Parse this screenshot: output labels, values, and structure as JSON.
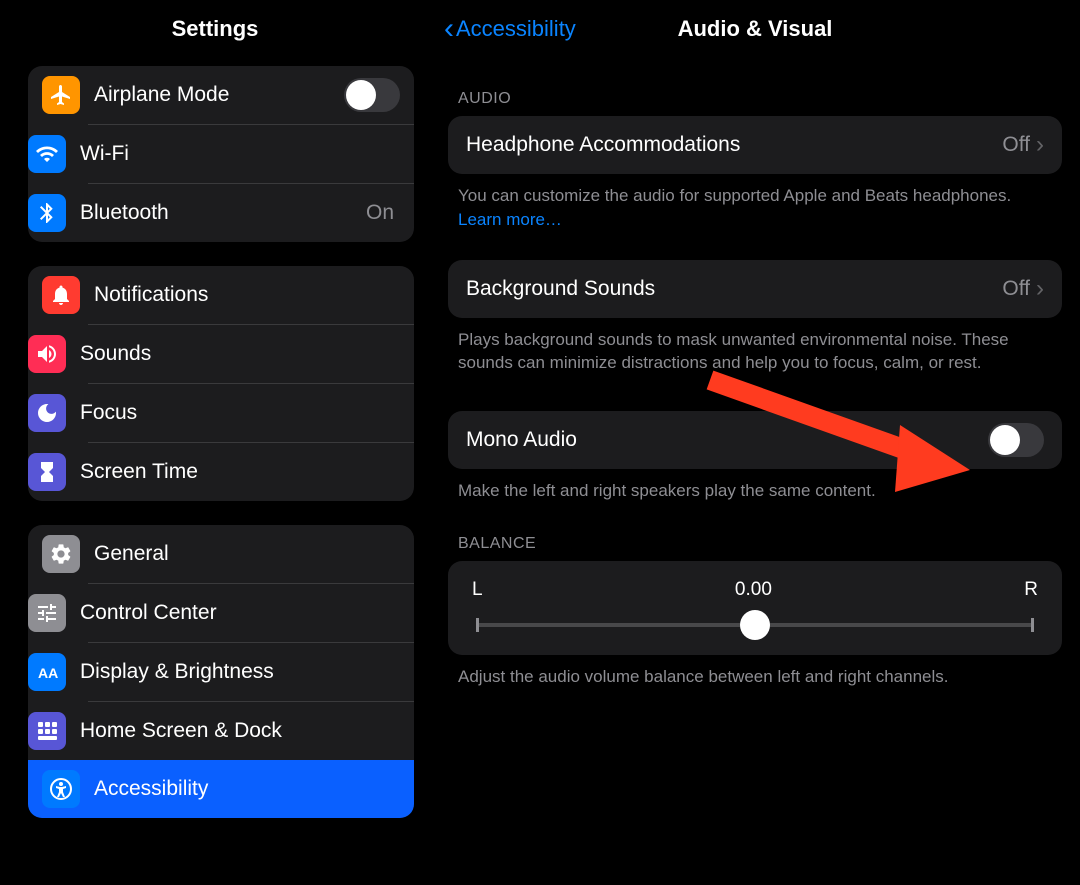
{
  "left": {
    "title": "Settings",
    "groups": [
      [
        {
          "label": "Airplane Mode",
          "value": null,
          "toggle": false
        },
        {
          "label": "Wi-Fi",
          "value": null
        },
        {
          "label": "Bluetooth",
          "value": "On"
        }
      ],
      [
        {
          "label": "Notifications"
        },
        {
          "label": "Sounds"
        },
        {
          "label": "Focus"
        },
        {
          "label": "Screen Time"
        }
      ],
      [
        {
          "label": "General"
        },
        {
          "label": "Control Center"
        },
        {
          "label": "Display & Brightness"
        },
        {
          "label": "Home Screen & Dock"
        },
        {
          "label": "Accessibility",
          "selected": true
        }
      ]
    ]
  },
  "right": {
    "back": "Accessibility",
    "title": "Audio & Visual",
    "audio_header": "AUDIO",
    "headphone": {
      "label": "Headphone Accommodations",
      "value": "Off"
    },
    "headphone_footer": "You can customize the audio for supported Apple and Beats headphones. ",
    "headphone_link": "Learn more…",
    "background": {
      "label": "Background Sounds",
      "value": "Off"
    },
    "background_footer": "Plays background sounds to mask unwanted environmental noise. These sounds can minimize distractions and help you to focus, calm, or rest.",
    "mono": {
      "label": "Mono Audio"
    },
    "mono_footer": "Make the left and right speakers play the same content.",
    "balance_header": "BALANCE",
    "balance": {
      "l": "L",
      "r": "R",
      "value": "0.00"
    },
    "balance_footer": "Adjust the audio volume balance between left and right channels."
  }
}
